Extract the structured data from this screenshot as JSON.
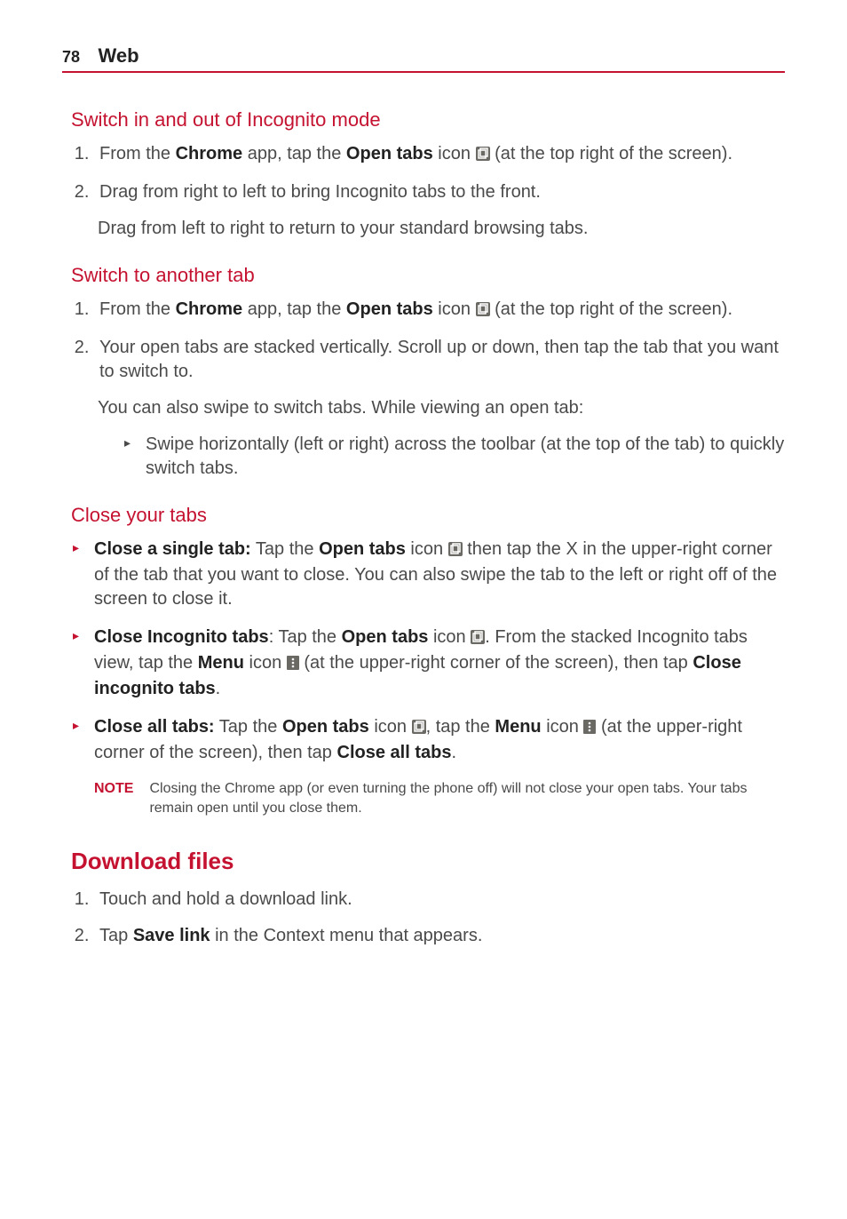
{
  "header": {
    "page_num": "78",
    "title": "Web"
  },
  "s1": {
    "heading": "Switch in and out of Incognito mode",
    "step1_a": "From the ",
    "step1_b": "Chrome",
    "step1_c": " app, tap the ",
    "step1_d": "Open tabs",
    "step1_e": " icon ",
    "step1_f": " (at the top right of the screen).",
    "step2": "Drag from right to left to bring Incognito tabs to the front.",
    "para": "Drag from left to right to return to your standard browsing tabs."
  },
  "s2": {
    "heading": "Switch to another tab",
    "step1_a": "From the ",
    "step1_b": "Chrome",
    "step1_c": " app, tap the ",
    "step1_d": "Open tabs",
    "step1_e": " icon ",
    "step1_f": " (at the top right of the screen).",
    "step2": "Your open tabs are stacked vertically. Scroll up or down, then tap the tab that you want to switch to.",
    "para": "You can also swipe to switch tabs. While viewing an open tab:",
    "bullet": "Swipe horizontally (left or right) across the toolbar (at the top of the tab) to quickly switch tabs."
  },
  "s3": {
    "heading": "Close your tabs",
    "b1_a": "Close a single tab:",
    "b1_b": " Tap the ",
    "b1_c": "Open tabs",
    "b1_d": " icon ",
    "b1_e": " then tap the X in the upper-right corner of the tab that you want to close. You can also swipe the tab to the left or right off of the screen to close it.",
    "b2_a": "Close Incognito tabs",
    "b2_b": ": Tap the ",
    "b2_c": "Open tabs",
    "b2_d": " icon ",
    "b2_e": ". From the stacked Incognito tabs view, tap the ",
    "b2_f": "Menu",
    "b2_g": " icon ",
    "b2_h": " (at the upper-right corner of the screen), then tap ",
    "b2_i": "Close incognito tabs",
    "b2_j": ".",
    "b3_a": "Close all tabs:",
    "b3_b": " Tap the ",
    "b3_c": "Open tabs",
    "b3_d": " icon ",
    "b3_e": ", tap the ",
    "b3_f": "Menu",
    "b3_g": " icon ",
    "b3_h": " (at the upper-right corner of the screen), then tap ",
    "b3_i": "Close all tabs",
    "b3_j": ".",
    "note_label": "NOTE",
    "note_text": "Closing the Chrome app (or even turning the phone off) will not close your open tabs. Your tabs remain open until you close them."
  },
  "s4": {
    "heading": "Download files",
    "step1": "Touch and hold a download link.",
    "step2_a": "Tap ",
    "step2_b": "Save link",
    "step2_c": " in the Context menu that appears."
  }
}
